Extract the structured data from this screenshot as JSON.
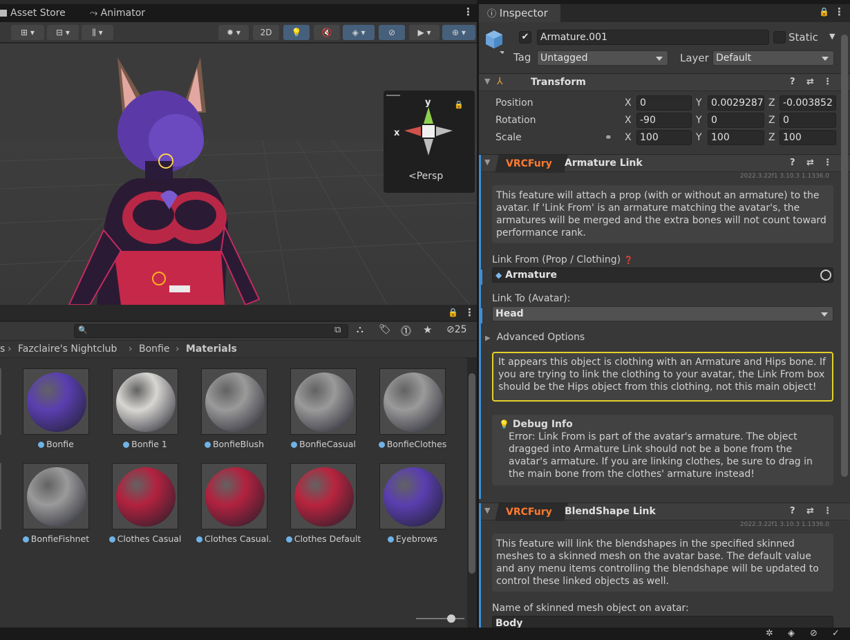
{
  "tabs": {
    "asset_store": "Asset Store",
    "animator": "Animator"
  },
  "scene_toolbar": {
    "twod": "2D"
  },
  "gizmo": {
    "y_axis": "y",
    "x_axis": "x",
    "projection": "Persp"
  },
  "project": {
    "visible_count": "25",
    "breadcrumb": [
      "s",
      "Fazclaire's Nightclub",
      "Bonfie",
      "Materials"
    ]
  },
  "assets": [
    {
      "name": "Bonfie",
      "color": "#5a3fb0"
    },
    {
      "name": "Bonfie 1",
      "color": "#d8d6d2"
    },
    {
      "name": "BonfieBlush",
      "color": "#9a9a9a"
    },
    {
      "name": "BonfieCasual",
      "color": "#9a9a9a"
    },
    {
      "name": "BonfieClothes",
      "color": "#9a9a9a"
    },
    {
      "name": "BonfieFishnet",
      "color": "#9a9a9a"
    },
    {
      "name": "Clothes Casual",
      "color": "#b2223f"
    },
    {
      "name": "Clothes Casual...",
      "color": "#b2223f"
    },
    {
      "name": "Clothes Default",
      "color": "#b8243e"
    },
    {
      "name": "Eyebrows",
      "color": "#5a3fb0"
    }
  ],
  "inspector": {
    "tab": "Inspector",
    "object_name": "Armature.001",
    "static_label": "Static",
    "tag_label": "Tag",
    "tag_value": "Untagged",
    "layer_label": "Layer",
    "layer_value": "Default",
    "transform": {
      "title": "Transform",
      "position_label": "Position",
      "rotation_label": "Rotation",
      "scale_label": "Scale",
      "x": "X",
      "y": "Y",
      "z": "Z",
      "position": [
        "0",
        "0.0029287",
        "-0.003852"
      ],
      "rotation": [
        "-90",
        "0",
        "0"
      ],
      "scale": [
        "100",
        "100",
        "100"
      ]
    },
    "armature_link": {
      "badge": "VRCFury",
      "title": "Armature Link",
      "version": "2022.3.22f1 3.10.3 1.1336.0",
      "description": "This feature will attach a prop (with or without an armature) to the avatar. If 'Link From' is an armature matching the avatar's, the armatures will be merged and the extra bones will not count toward performance rank.",
      "link_from_label": "Link From (Prop / Clothing)",
      "link_from_value": "Armature",
      "link_to_label": "Link To (Avatar):",
      "link_to_value": "Head",
      "advanced_label": "Advanced Options",
      "warning": "It appears this object is clothing with an Armature and Hips bone. If you are trying to link the clothing to your avatar, the Link From box should be the Hips object from this clothing, not this main object!",
      "debug_title": "Debug Info",
      "debug_text": "Error: Link From is part of the avatar's armature. The object dragged into Armature Link should not be a bone from the avatar's armature. If you are linking clothes, be sure to drag in the main bone from the clothes' armature instead!"
    },
    "blendshape_link": {
      "badge": "VRCFury",
      "title": "BlendShape Link",
      "version": "2022.3.22f1 3.10.3 1.1336.0",
      "description": "This feature will link the blendshapes in the specified skinned meshes to a skinned mesh on the avatar base. The default value and any menu items controlling the blendshape will be updated to control these linked objects as well.",
      "mesh_label": "Name of skinned mesh object on avatar:",
      "mesh_value": "Body"
    }
  }
}
